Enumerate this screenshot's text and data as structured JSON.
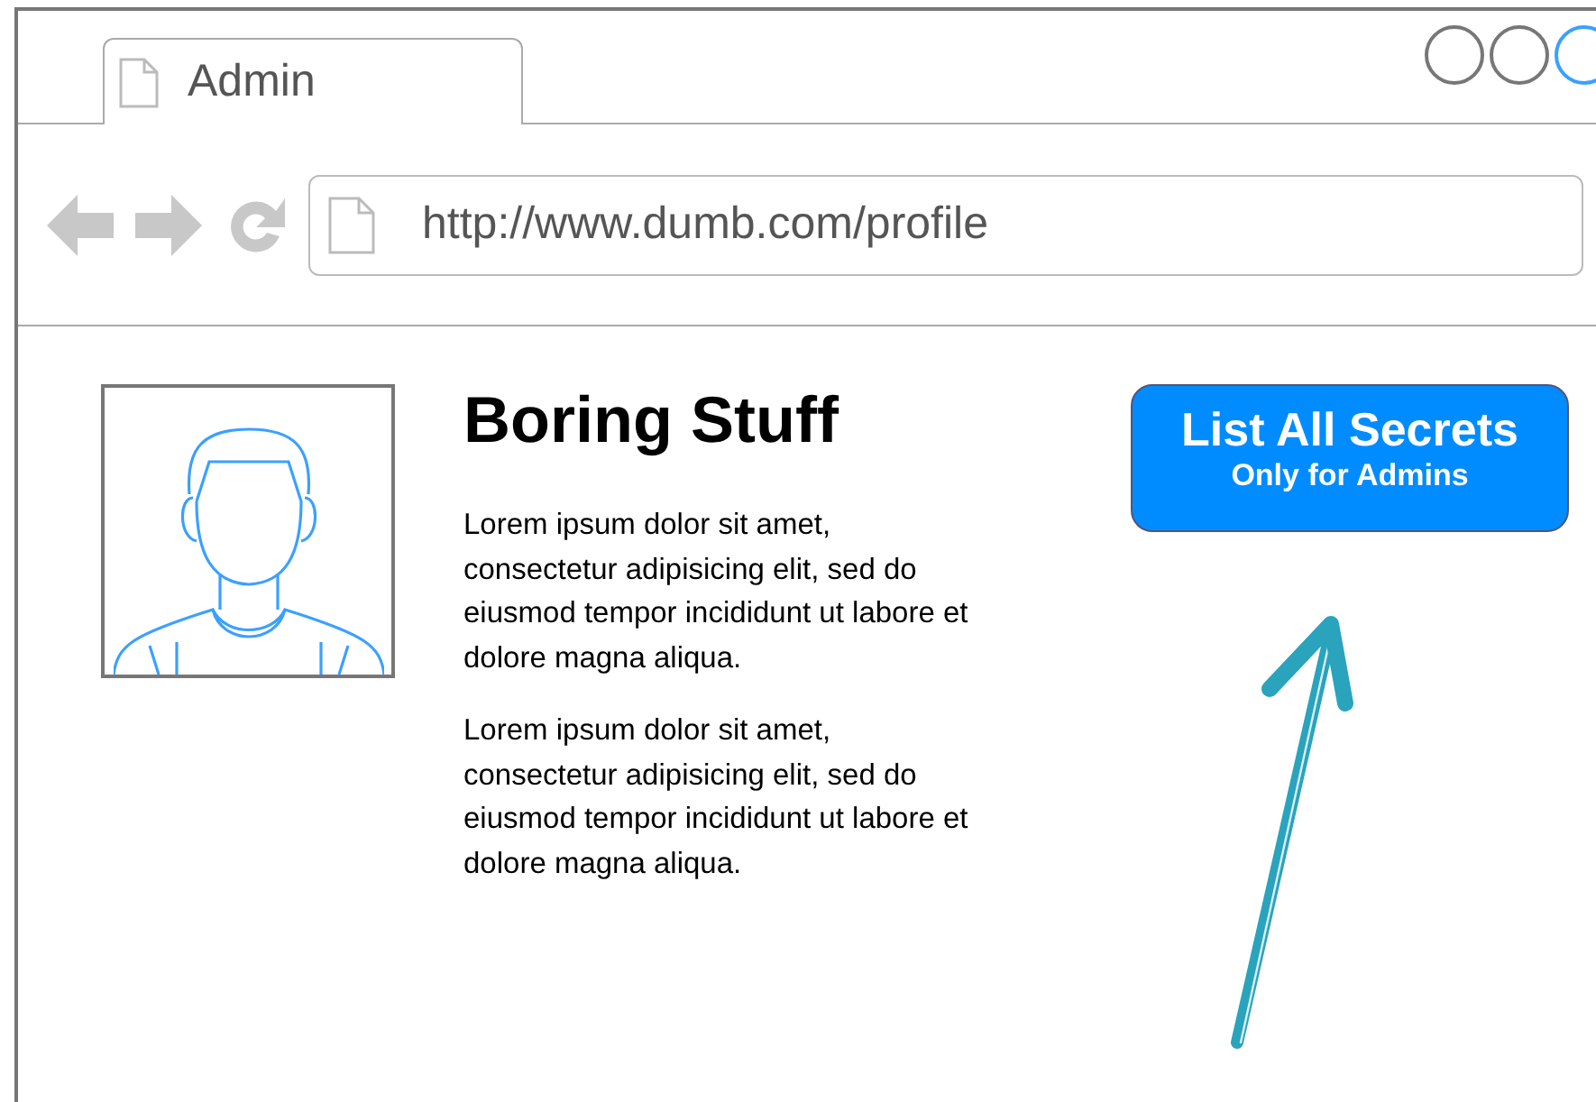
{
  "window": {
    "controls": [
      {
        "highlighted": false
      },
      {
        "highlighted": false
      },
      {
        "highlighted": true
      }
    ]
  },
  "tabs": [
    {
      "label": "Admin",
      "selected": true
    }
  ],
  "address_bar": {
    "value": "http://www.dumb.com/profile"
  },
  "content": {
    "heading": "Boring Stuff",
    "paragraphs": [
      "Lorem ipsum dolor sit amet, consectetur adipisicing elit, sed do eiusmod tempor incididunt ut labore et dolore magna aliqua.",
      "Lorem ipsum dolor sit amet, consectetur adipisicing elit, sed do eiusmod tempor incididunt ut labore et dolore magna aliqua."
    ],
    "button": {
      "label": "List All Secrets",
      "sublabel": "Only for Admins"
    }
  }
}
